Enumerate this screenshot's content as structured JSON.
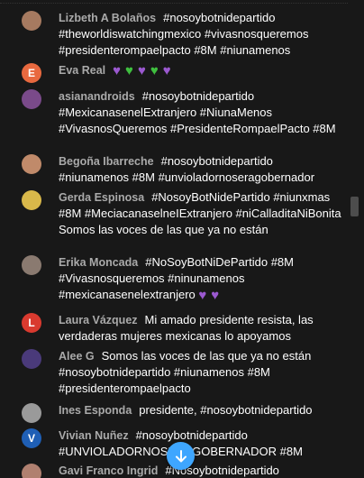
{
  "messages": [
    {
      "author": "Lizbeth A Bolaños",
      "text": "#nosoybotnidepartido #theworldiswatchingmexico #vivasnosqueremos #presidenterompaelpacto #8M #niunamenos",
      "emojis": [],
      "avatar": {
        "initial": "",
        "color": "#a67a60"
      }
    },
    {
      "author": "Eva Real",
      "text": "",
      "emojis": [
        "purple-heart",
        "green-heart",
        "purple-heart",
        "green-heart",
        "purple-heart"
      ],
      "avatar": {
        "initial": "E",
        "color": "#e8693f"
      }
    },
    {
      "author": "asianandroids",
      "text": "#nosoybotnidepartido #MexicanasenelExtranjero #NiunaMenos #VivasnosQueremos #PresidenteRompaelPacto #8M",
      "emojis": [],
      "avatar": {
        "initial": "",
        "color": "#7a4a8a"
      }
    },
    {
      "author": "Begoña Ibarreche",
      "text": "#nosoybotnidepartido #niunamenos #8M #unvioladornoseragobernador",
      "emojis": [],
      "avatar": {
        "initial": "",
        "color": "#c08a6a"
      }
    },
    {
      "author": "Gerda Espinosa",
      "text": "#NosoyBotNidePartido #niunxmas #8M #MeciacanaselneIExtranjero #niCalladitaNiBonita Somos las voces de las que ya no están",
      "emojis": [],
      "avatar": {
        "initial": "",
        "color": "#d9b84a"
      }
    },
    {
      "author": "Erika Moncada",
      "text": "#NoSoyBotNiDePartido #8M #Vivasnosqueremos #ninunamenos #mexicanasenelextranjero",
      "emojis": [
        "purple-heart",
        "purple-heart"
      ],
      "avatar": {
        "initial": "",
        "color": "#8a7a70"
      }
    },
    {
      "author": "Laura Vázquez",
      "text": "Mi amado presidente resista, las verdaderas mujeres mexicanas lo apoyamos",
      "emojis": [],
      "avatar": {
        "initial": "L",
        "color": "#d93a2f"
      }
    },
    {
      "author": "Alee G",
      "text": "Somos las voces de las que ya no están #nosoybotnidepartido #niunamenos #8M #presidenterompaelpacto",
      "emojis": [],
      "avatar": {
        "initial": "",
        "color": "#4a3a7a"
      }
    },
    {
      "author": "Ines Esponda",
      "text": "presidente, #nosoybotnidepartido",
      "emojis": [],
      "avatar": {
        "initial": "",
        "color": "#9a9a9a"
      }
    },
    {
      "author": "Vivian Nuñez",
      "text": "#nosoybotnidepartido #UNVIOLADORNOSERAGOBERNADOR #8M",
      "emojis": [],
      "avatar": {
        "initial": "V",
        "color": "#1f5fb5"
      }
    },
    {
      "author": "Gavi Franco Ingrid",
      "text": "#Nosoybotnidepartido",
      "emojis": [],
      "avatar": {
        "initial": "",
        "color": "#b08070"
      }
    }
  ],
  "icons": {
    "purple-heart": "💜",
    "green-heart": "💚",
    "jump-down": "arrow-down-icon"
  },
  "colors": {
    "background": "#181818",
    "author": "#aaaaaa",
    "accent": "#3ea6ff"
  }
}
